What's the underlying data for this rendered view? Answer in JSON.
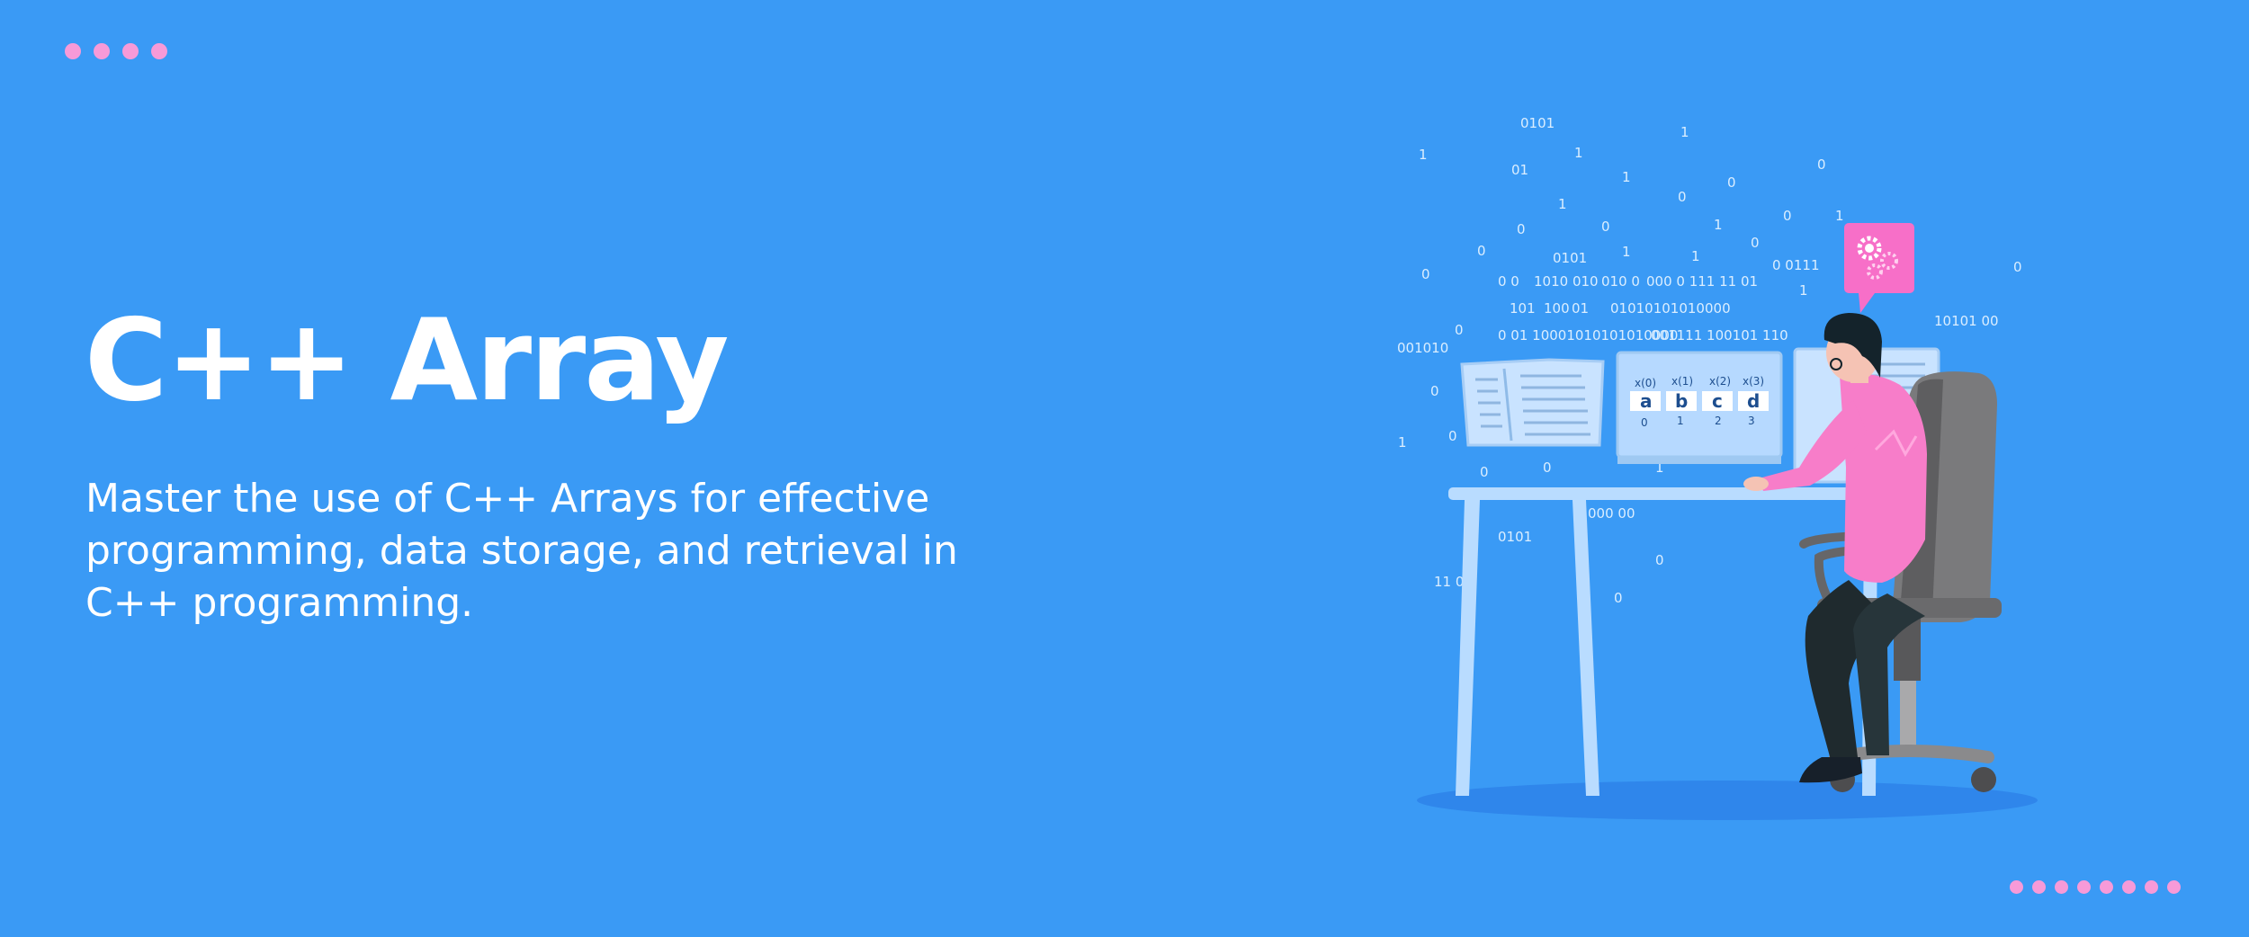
{
  "banner": {
    "title": "C++ Array",
    "subtitle": "Master the use of C++ Arrays for effective programming, data storage, and retrieval in C++ programming."
  },
  "colors": {
    "background": "#3a9af5",
    "accent_dots": "#f79ad8",
    "text": "#ffffff"
  },
  "illustration": {
    "array_cells": [
      {
        "header": "x(0)",
        "value": "a",
        "index": "0"
      },
      {
        "header": "x(1)",
        "value": "b",
        "index": "1"
      },
      {
        "header": "x(2)",
        "value": "c",
        "index": "2"
      },
      {
        "header": "x(3)",
        "value": "d",
        "index": "3"
      }
    ],
    "binary_text": [
      "0101",
      "1",
      "1",
      "1",
      "01",
      "1",
      "0",
      "0",
      "1",
      "0",
      "0",
      "0",
      "1",
      "0",
      "0101",
      "0",
      "1",
      "1",
      "1",
      "0",
      "0 0111",
      "0",
      "0 0",
      "1010 010",
      "010 0",
      "000 0 111 11 01",
      "1",
      "101",
      "100",
      "01",
      "01010101010000",
      "0 01 10001010101010000",
      "001111 100101 110",
      "10101 00",
      "001010",
      "0",
      "0",
      "1",
      "0",
      "0",
      "0",
      "1",
      "0101",
      "11 01",
      "000 00",
      "0",
      "0",
      "0"
    ],
    "icons": [
      "gears-icon"
    ]
  }
}
